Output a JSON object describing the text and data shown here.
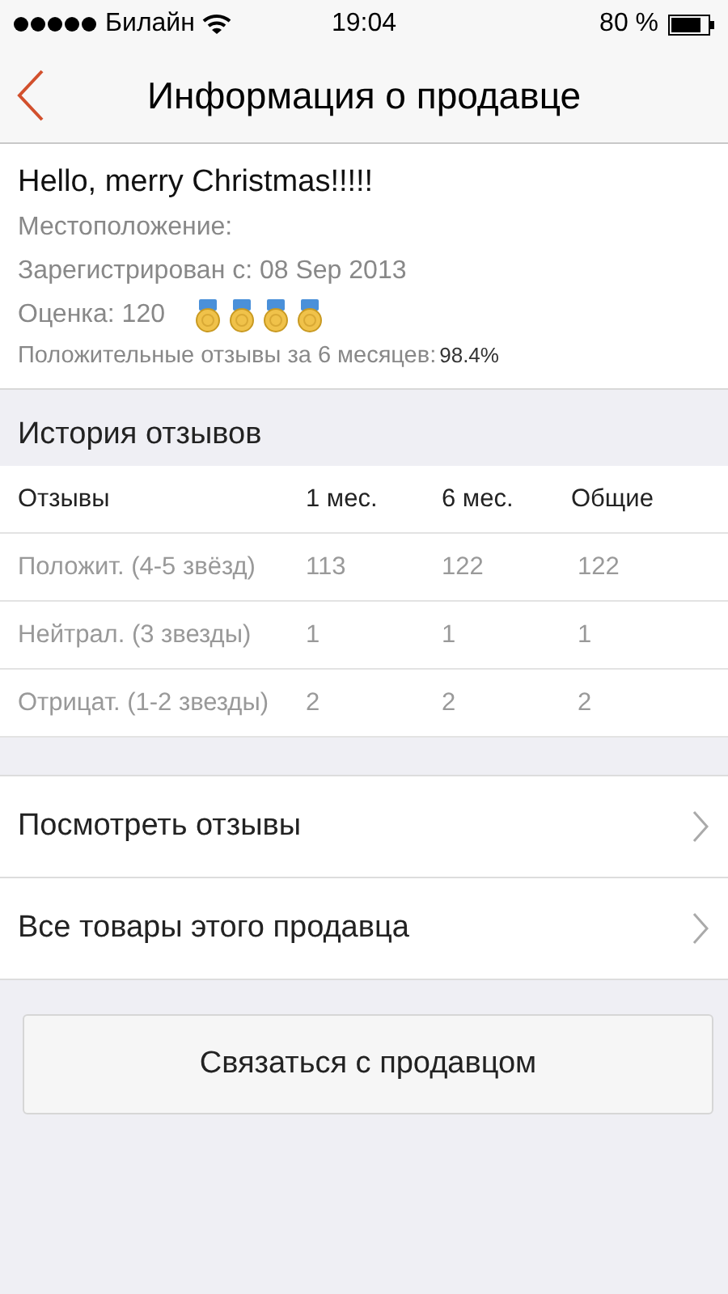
{
  "status_bar": {
    "carrier": "Билайн",
    "time": "19:04",
    "battery": "80 %"
  },
  "nav": {
    "title": "Информация о продавце"
  },
  "seller": {
    "name": "Hello, merry Christmas!!!!!",
    "location": "Местоположение:",
    "registered": "Зарегистрирован с: 08 Sep 2013",
    "rating": {
      "label": "Оценка: 120",
      "stars": 4
    },
    "positive_label": "Положительные отзывы за 6 месяцев:",
    "positive_value": "98.4%"
  },
  "history": {
    "title": "История отзывов",
    "columns": [
      "Отзывы",
      "1 мес.",
      "6 мес.",
      "Общие"
    ],
    "rows": [
      [
        "Положит. (4-5 звёзд)",
        "113",
        "122",
        "122"
      ],
      [
        "Нейтрал. (3 звезды)",
        "1",
        "1",
        "1"
      ],
      [
        "Отрицат. (1-2 звезды)",
        "2",
        "2",
        "2"
      ]
    ]
  },
  "links": [
    "Посмотреть отзывы",
    "Все товары этого продавца"
  ],
  "contact_button": "Связаться с продавцом"
}
